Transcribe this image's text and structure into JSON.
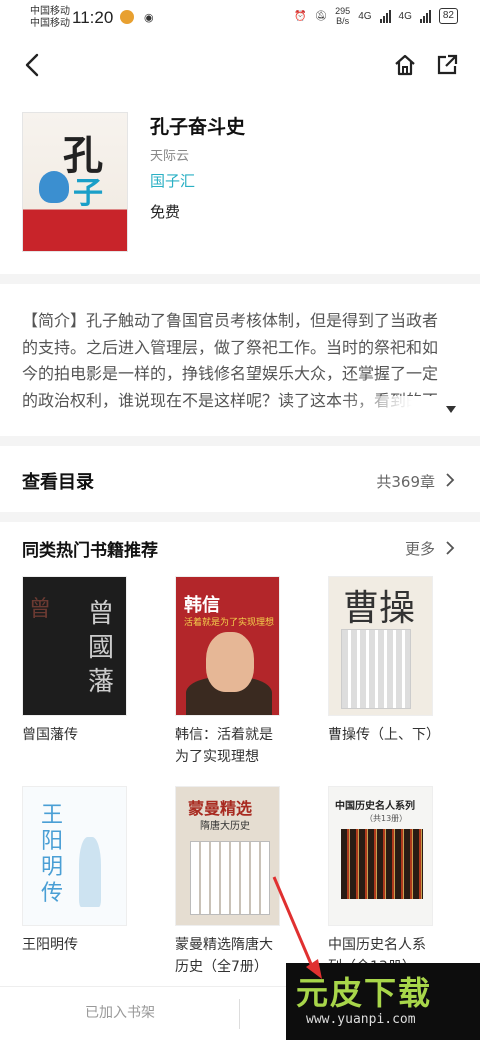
{
  "status_bar": {
    "carrier_1": "中国移动",
    "carrier_2": "中国移动",
    "time": "11:20",
    "speed_value": "295",
    "speed_unit": "B/s",
    "network_1": "4G",
    "network_2": "4G",
    "battery": "82"
  },
  "nav": {
    "back_icon": "back-arrow-icon",
    "home_icon": "home-icon",
    "share_icon": "share-icon"
  },
  "book": {
    "title": "孔子奋斗史",
    "author": "天际云",
    "publisher": "国子汇",
    "price": "免费",
    "cover_text_1": "孔",
    "cover_text_2": "子"
  },
  "intro": {
    "text": "【简介】孔子触动了鲁国官员考核体制，但是得到了当政者的支持。之后进入管理层，做了祭祀工作。当时的祭祀和如今的拍电影是一样的，挣钱修名望娱乐大众，还掌握了一定的政治权利，谁说现在不是这样呢？读了这本书，看到的不仅仅是那段历史，也不仅仅是对如今社会的映射。从这本书看到的，"
  },
  "catalog": {
    "label": "查看目录",
    "count": "共369章"
  },
  "recommend": {
    "title": "同类热门书籍推荐",
    "more": "更多",
    "items": [
      {
        "name": "曾国藩传",
        "cover_title": "曾國藩",
        "cover_sub": "曾"
      },
      {
        "name": "韩信：活着就是为了实现理想",
        "cover_title": "韩信",
        "cover_sub": "活着就是为了实现理想"
      },
      {
        "name": "曹操传（上、下）",
        "cover_title": "曹操传"
      },
      {
        "name": "王阳明传",
        "cover_title": "王阳明传"
      },
      {
        "name": "蒙曼精选隋唐大历史（全7册）",
        "cover_title": "蒙曼精选",
        "cover_sub": "隋唐大历史"
      },
      {
        "name": "中国历史名人系列（全13册）",
        "cover_title": "中国历史名人系列",
        "cover_sub": "（共13册）"
      }
    ]
  },
  "bottom": {
    "shelf_label": "已加入书架"
  },
  "watermark": {
    "brand": "元皮下载",
    "url": "www.yuanpi.com"
  },
  "colors": {
    "publisher": "#2bb0c4",
    "annotation_arrow": "#e03030",
    "watermark_green": "#a8d64a"
  }
}
